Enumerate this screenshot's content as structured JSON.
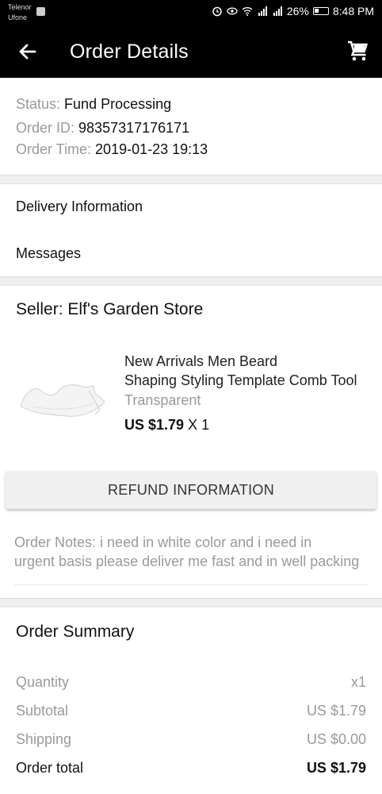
{
  "status_bar": {
    "carrier_1": "Telenor",
    "carrier_2": "Ufone",
    "battery": "26%",
    "time": "8:48 PM"
  },
  "app_bar": {
    "title": "Order Details",
    "back_icon": "arrow-left-icon",
    "cart_icon": "shopping-cart-icon"
  },
  "order": {
    "status_label": "Status:",
    "status_value": "Fund Processing",
    "id_label": "Order ID:",
    "id_value": "98357317176171",
    "time_label": "Order Time:",
    "time_value": "2019-01-23 19:13"
  },
  "links": {
    "delivery": "Delivery Information",
    "messages": "Messages"
  },
  "seller": {
    "label": "Seller: Elf's Garden Store"
  },
  "product": {
    "title_line1": "New Arrivals Men Beard",
    "title_line2": "Shaping Styling Template Comb Tool",
    "variant": "Transparent",
    "price": "US $1.79",
    "quantity": "X 1"
  },
  "refund_button": "REFUND INFORMATION",
  "notes": {
    "label": "Order Notes:",
    "line1": " i need in white color and i need in",
    "line2": "urgent basis please deliver me fast and in well packing"
  },
  "summary": {
    "title": "Order Summary",
    "quantity_label": "Quantity",
    "quantity_value": "x1",
    "subtotal_label": "Subtotal",
    "subtotal_value": "US $1.79",
    "shipping_label": "Shipping",
    "shipping_value": "US $0.00",
    "total_label": "Order total",
    "total_value": "US $1.79"
  }
}
